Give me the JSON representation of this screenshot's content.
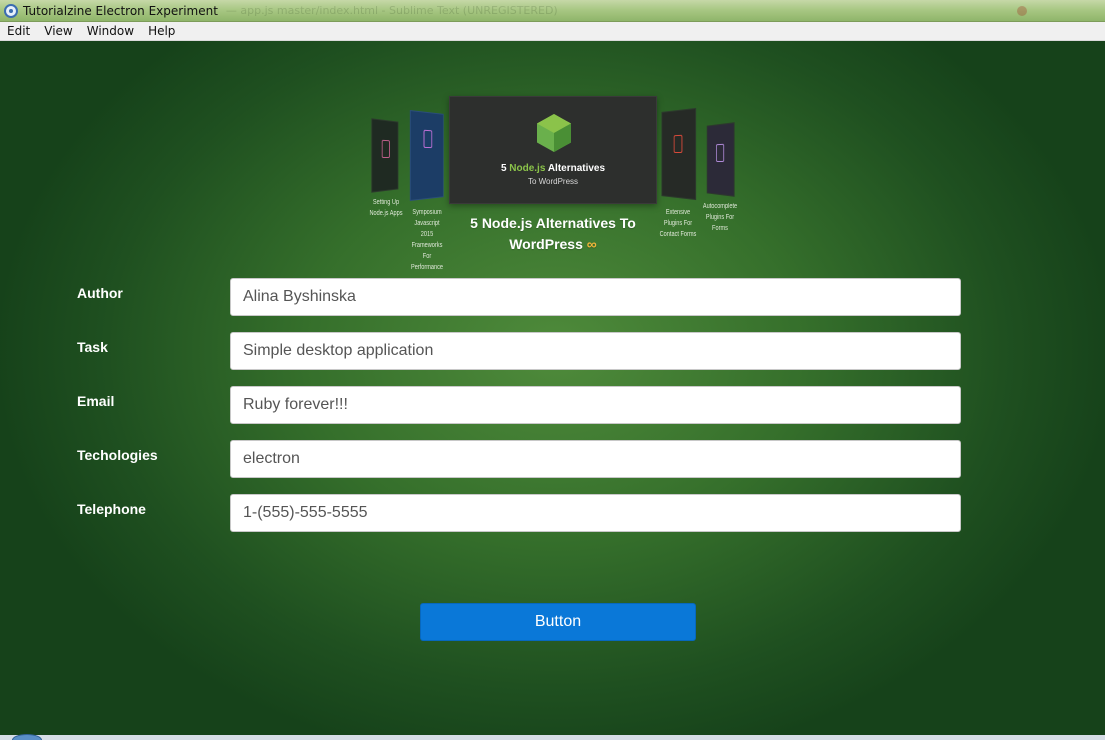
{
  "window": {
    "title": "Tutorialzine Electron Experiment",
    "title_ghost": "— app.js master/index.html - Sublime Text (UNREGISTERED)"
  },
  "menu": {
    "items": [
      {
        "label": "Edit"
      },
      {
        "label": "View"
      },
      {
        "label": "Window"
      },
      {
        "label": "Help"
      }
    ]
  },
  "carousel": {
    "main": {
      "card_title_prefix": "5 ",
      "card_title_highlight": "Node.js",
      "card_title_suffix": " Alternatives",
      "card_subtitle": "To WordPress",
      "caption": "5 Node.js Alternatives To WordPress",
      "caption_icon": "∞",
      "accent": "#8bc34a",
      "icon_color": "#f4b53a"
    },
    "side_captions": [
      "Setting Up Node.js Apps",
      "Symposium Javascript 2015 Frameworks For Performance",
      "Extensive Plugins For Contact Forms",
      "Autocomplete Plugins For Forms"
    ]
  },
  "form": {
    "fields": [
      {
        "label": "Author",
        "value": "Alina Byshinska"
      },
      {
        "label": "Task",
        "value": "Simple desktop application"
      },
      {
        "label": "Email",
        "value": "Ruby forever!!!"
      },
      {
        "label": "Techologies",
        "value": "electron"
      },
      {
        "label": "Telephone",
        "value": "1-(555)-555-5555"
      }
    ],
    "button_label": "Button",
    "button_color": "#0a78d8"
  },
  "icons": {
    "app": "electron-app-icon",
    "card": "nodejs-hexagon-icon"
  }
}
